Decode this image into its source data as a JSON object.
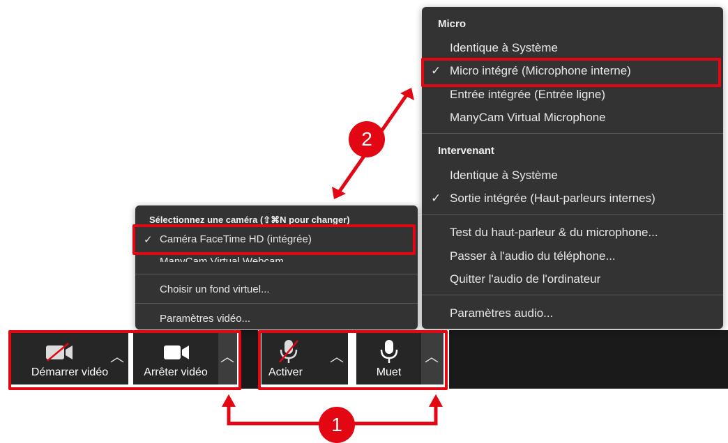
{
  "audio_menu": {
    "section_micro": "Micro",
    "micro_items": [
      {
        "label": "Identique à Système",
        "checked": false
      },
      {
        "label": "Micro intégré (Microphone interne)",
        "checked": true
      },
      {
        "label": "Entrée intégrée (Entrée ligne)",
        "checked": false
      },
      {
        "label": "ManyCam Virtual Microphone",
        "checked": false
      }
    ],
    "section_speaker": "Intervenant",
    "speaker_items": [
      {
        "label": "Identique à Système",
        "checked": false
      },
      {
        "label": "Sortie intégrée (Haut-parleurs internes)",
        "checked": true
      }
    ],
    "actions": [
      "Test du haut-parleur & du microphone...",
      "Passer à l'audio du téléphone...",
      "Quitter l'audio de l'ordinateur"
    ],
    "settings": "Paramètres audio..."
  },
  "video_menu": {
    "header": "Sélectionnez une caméra (⇧⌘N pour changer)",
    "cameras": [
      {
        "label": "Caméra FaceTime HD (intégrée)",
        "checked": true
      },
      {
        "label": "ManyCam Virtual Webcam",
        "checked": false
      }
    ],
    "virtual_bg": "Choisir un fond virtuel...",
    "settings": "Paramètres vidéo..."
  },
  "toolbar": {
    "start_video": "Démarrer vidéo",
    "stop_video": "Arrêter vidéo",
    "unmute": "Activer",
    "mute": "Muet"
  },
  "annotations": {
    "badge_1": "1",
    "badge_2": "2",
    "color": "#e30613"
  },
  "check_glyph": "✓"
}
